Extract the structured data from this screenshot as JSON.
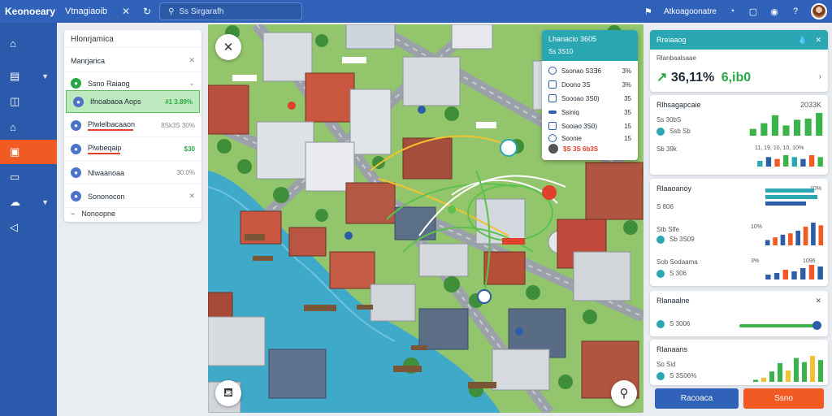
{
  "app": {
    "brand": "Keonoeary",
    "tab_label": "Vtnagiaoib",
    "search_placeholder": "Ss Sirgarafh",
    "user_label": "Atkoagoonatre"
  },
  "sidebar": {
    "items": [
      {
        "icon": "home-icon"
      },
      {
        "icon": "building-icon"
      },
      {
        "icon": "book-icon"
      },
      {
        "icon": "warehouse-icon"
      },
      {
        "icon": "camera-icon"
      },
      {
        "icon": "folder-icon"
      },
      {
        "icon": "cloud-icon"
      },
      {
        "icon": "location-icon"
      }
    ],
    "active_index": 4
  },
  "mission": {
    "title": "Hlonrjamica",
    "rows": [
      {
        "label": "Manrjarica",
        "value": ""
      },
      {
        "label": "Ssno Raiaog",
        "value": ""
      },
      {
        "label": "Ifnoabaoa Aops",
        "value": "#1 3.89%"
      },
      {
        "label": "Plwlelbacaaon",
        "value": "8Sk3S 30%"
      },
      {
        "label": "Plwbeqaip",
        "value": "$30"
      },
      {
        "label": "Nlwaanoaa",
        "value": "30.0%"
      },
      {
        "label": "Sononocon",
        "value": ""
      },
      {
        "label": "Nonoopne",
        "value": ""
      }
    ]
  },
  "popup": {
    "title": "Lhanacio 3605",
    "subtitle": "Ss 3S10",
    "rows": [
      {
        "label": "Ssonao S3Ǝ6",
        "value": "3%"
      },
      {
        "label": "Doono 3S",
        "value": "3%"
      },
      {
        "label": "Soooao 3S0)",
        "value": "35"
      },
      {
        "label": "Ssiniq",
        "value": "35"
      },
      {
        "label": "Sooiao 3S0)",
        "value": "15"
      },
      {
        "label": "Soonie",
        "value": "15"
      }
    ],
    "footer": "$S 3S 6b3S"
  },
  "right": {
    "summary": {
      "title": "Rreiaaog",
      "subtitle": "Rlanbaalsaae",
      "big": "36,11%",
      "big2": "6,ib0"
    },
    "card2": {
      "title": "Rlhsagapcaie",
      "value": "2033K",
      "s1": "Ss 30bS",
      "s2": "Ssb Sb",
      "s3": "Sb 39k",
      "scale": "11, 19, 10, 10, 10%"
    },
    "card3": {
      "title": "Rlaaoanoy",
      "pct": "10%",
      "s1": "S 806",
      "s2": "Stb Slfe",
      "s3": "Sb 3S09",
      "s4": "Sob Sodaama",
      "s5": "S 306",
      "pct2": "10%",
      "pct3": "3%",
      "pct4": "1096"
    },
    "card4": {
      "title": "Rlanaalne",
      "value": "S 3006"
    },
    "card5": {
      "title": "Rlanaans",
      "value": "S 3S06%",
      "lbl": "So Sid"
    },
    "buttons": {
      "left": "Racoaca",
      "right": "Ssno"
    }
  },
  "chart_data": [
    {
      "type": "bar",
      "name": "card2-bars",
      "values": [
        6,
        11,
        18,
        9,
        14,
        15,
        20
      ]
    },
    {
      "type": "bar",
      "name": "card2-bars-small",
      "values": [
        3,
        5,
        4,
        6,
        5,
        4,
        6,
        5
      ]
    },
    {
      "type": "bar",
      "name": "card3-bars",
      "values": [
        4,
        6,
        8,
        9,
        11,
        14,
        17,
        15
      ]
    },
    {
      "type": "bar",
      "name": "card3-bars-bottom",
      "values": [
        3,
        4,
        6,
        5,
        7,
        9,
        8
      ]
    },
    {
      "type": "bar",
      "name": "card5-bars",
      "values": [
        2,
        4,
        10,
        18,
        11,
        23,
        19,
        25,
        21
      ]
    }
  ],
  "colors": {
    "topbar": "#2f62b8",
    "accent_orange": "#f25a23",
    "teal": "#2aa7b3",
    "green": "#3ab44a"
  }
}
